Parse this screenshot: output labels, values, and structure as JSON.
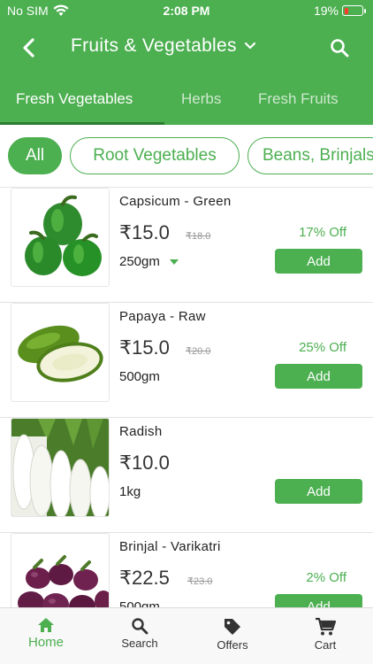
{
  "status": {
    "carrier": "No SIM",
    "time": "2:08 PM",
    "battery": "19%"
  },
  "appbar": {
    "title": "Fruits & Vegetables"
  },
  "tabs": [
    {
      "label": "Fresh Vegetables"
    },
    {
      "label": "Herbs"
    },
    {
      "label": "Fresh Fruits"
    }
  ],
  "chips": [
    {
      "label": "All"
    },
    {
      "label": "Root Vegetables"
    },
    {
      "label": "Beans, Brinjals"
    }
  ],
  "products": [
    {
      "name": "Capsicum - Green",
      "price": "₹15.0",
      "mrp": "₹18.0",
      "qty": "250gm",
      "discount": "17% Off",
      "add": "Add"
    },
    {
      "name": "Papaya - Raw",
      "price": "₹15.0",
      "mrp": "₹20.0",
      "qty": "500gm",
      "discount": "25% Off",
      "add": "Add"
    },
    {
      "name": "Radish",
      "price": "₹10.0",
      "mrp": "",
      "qty": "1kg",
      "discount": "",
      "add": "Add"
    },
    {
      "name": "Brinjal - Varikatri",
      "price": "₹22.5",
      "mrp": "₹23.0",
      "qty": "500gm",
      "discount": "2% Off",
      "add": "Add"
    }
  ],
  "nav": {
    "home": "Home",
    "search": "Search",
    "offers": "Offers",
    "cart": "Cart"
  },
  "colors": {
    "primary": "#4caf50",
    "tab_indicator": "#2e7d32",
    "battery_low": "#ff3b30"
  },
  "icons": [
    "wifi-icon",
    "battery-icon",
    "back-arrow-icon",
    "chevron-down-icon",
    "search-icon",
    "home-icon",
    "tag-icon",
    "cart-icon"
  ]
}
